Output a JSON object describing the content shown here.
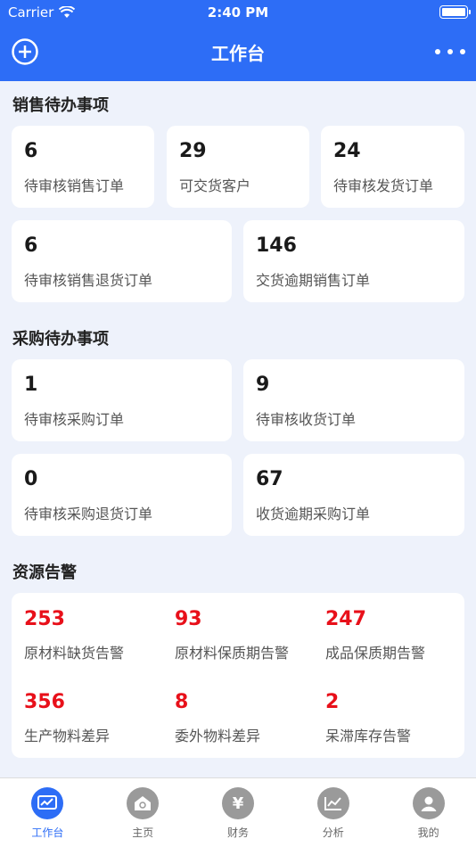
{
  "status": {
    "carrier": "Carrier",
    "time": "2:40 PM"
  },
  "nav": {
    "title": "工作台"
  },
  "sales": {
    "title": "销售待办事项",
    "items": [
      {
        "value": "6",
        "label": "待审核销售订单"
      },
      {
        "value": "29",
        "label": "可交货客户"
      },
      {
        "value": "24",
        "label": "待审核发货订单"
      },
      {
        "value": "6",
        "label": "待审核销售退货订单"
      },
      {
        "value": "146",
        "label": "交货逾期销售订单"
      }
    ]
  },
  "purchase": {
    "title": "采购待办事项",
    "items": [
      {
        "value": "1",
        "label": "待审核采购订单"
      },
      {
        "value": "9",
        "label": "待审核收货订单"
      },
      {
        "value": "0",
        "label": "待审核采购退货订单"
      },
      {
        "value": "67",
        "label": "收货逾期采购订单"
      }
    ]
  },
  "alerts": {
    "title": "资源告警",
    "items": [
      {
        "value": "253",
        "label": "原材料缺货告警"
      },
      {
        "value": "93",
        "label": "原材料保质期告警"
      },
      {
        "value": "247",
        "label": "成品保质期告警"
      },
      {
        "value": "356",
        "label": "生产物料差异"
      },
      {
        "value": "8",
        "label": "委外物料差异"
      },
      {
        "value": "2",
        "label": "呆滞库存告警"
      }
    ],
    "color": "#e8101a"
  },
  "tabs": [
    {
      "label": "工作台",
      "icon": "dashboard-icon"
    },
    {
      "label": "主页",
      "icon": "home-icon"
    },
    {
      "label": "财务",
      "icon": "yen-icon"
    },
    {
      "label": "分析",
      "icon": "chart-icon"
    },
    {
      "label": "我的",
      "icon": "user-icon"
    }
  ],
  "accent": "#2d6df6"
}
